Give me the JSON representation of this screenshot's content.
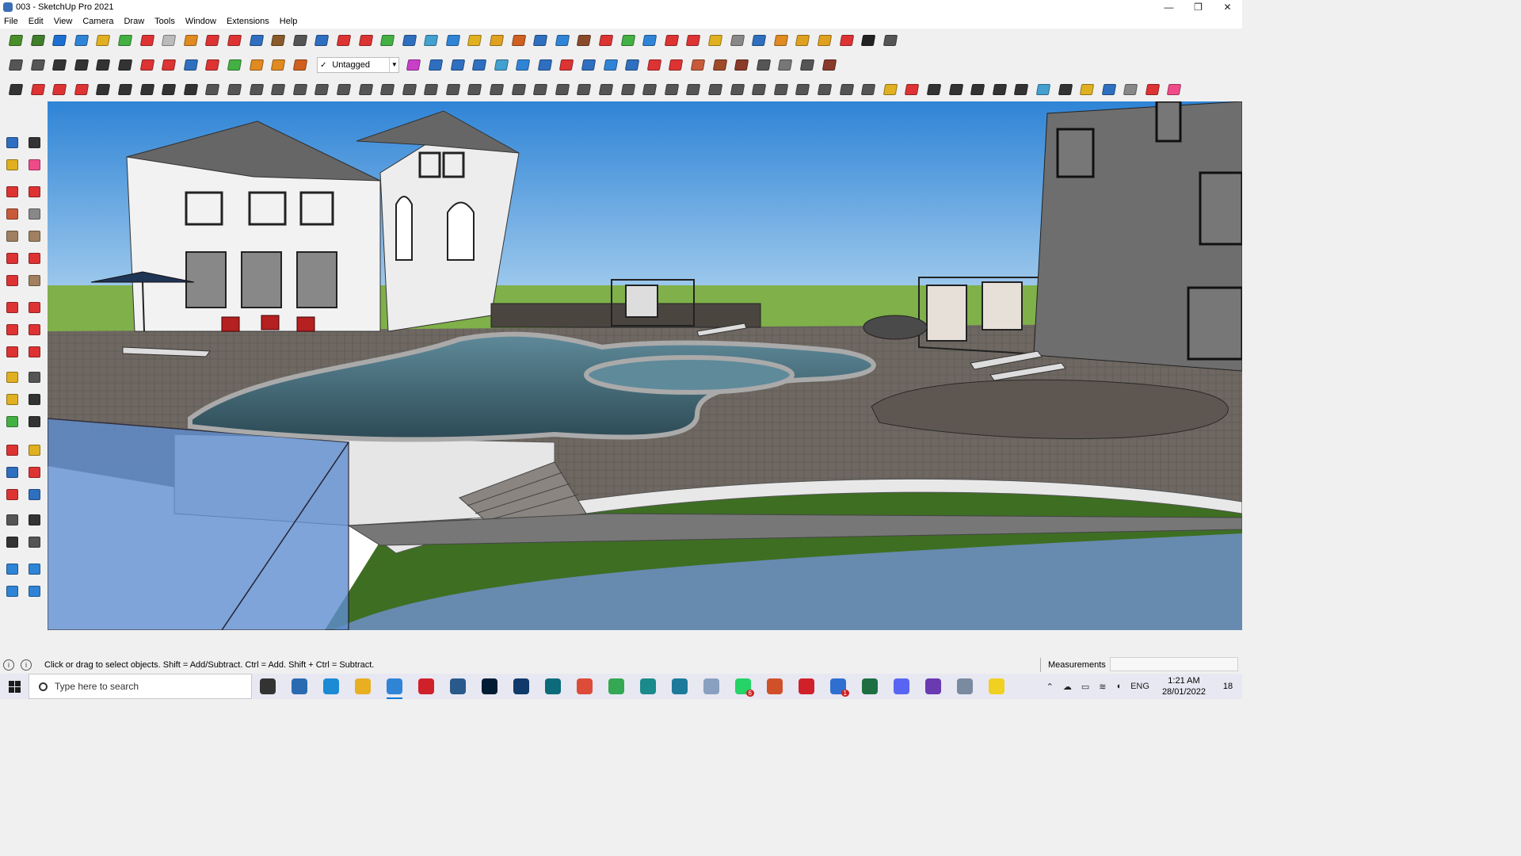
{
  "window": {
    "title": "003 - SketchUp Pro 2021",
    "controls": {
      "minimize": "—",
      "maximize": "❐",
      "close": "✕"
    }
  },
  "menu": [
    "File",
    "Edit",
    "View",
    "Camera",
    "Draw",
    "Tools",
    "Window",
    "Extensions",
    "Help"
  ],
  "tag_selector": {
    "check": "✓",
    "value": "Untagged",
    "arrow": "▼"
  },
  "toolbar_colors": {
    "row1": [
      "#4a8f2a",
      "#3f7f2a",
      "#1e6fd1",
      "#2f84d6",
      "#e0b020",
      "#43b043",
      "#d33",
      "#bbb",
      "#e08a20",
      "#d33",
      "#d33",
      "#2f6fc0",
      "#8a5a2a",
      "#555",
      "#2f6fc0",
      "#d33",
      "#d33",
      "#43b043",
      "#2f6fc0",
      "#43a0d0",
      "#2f84d6",
      "#e0b020",
      "#e0a020",
      "#d06020",
      "#2f6fc0",
      "#2f84d6",
      "#8a4a2a",
      "#d33",
      "#43b043",
      "#2f84d6",
      "#d33",
      "#d33",
      "#e0b020",
      "#888",
      "#2f6fc0",
      "#e08a20",
      "#e0a020",
      "#e0a020",
      "#d33",
      "#222",
      "#555"
    ],
    "row2": [
      "#555",
      "#555",
      "#333",
      "#333",
      "#333",
      "#333",
      "#d33",
      "#d33",
      "#2f6fc0",
      "#d33",
      "#43b043",
      "#e08a20",
      "#e08a20",
      "#d06020",
      "#c83fc8",
      "#2f6fc0",
      "#2f6fc0",
      "#2f6fc0",
      "#43a0d0",
      "#2f84d6",
      "#2f6fc0",
      "#d33",
      "#2f6fc0",
      "#2f84d6",
      "#2f6fc0",
      "#d33",
      "#d33",
      "#c85a3a",
      "#a04a2a",
      "#8a3a2a",
      "#555",
      "#777",
      "#555",
      "#8a3a2a"
    ],
    "row3": [
      "#333",
      "#d33",
      "#d33",
      "#d33",
      "#333",
      "#333",
      "#333",
      "#333",
      "#333",
      "#555",
      "#555",
      "#555",
      "#555",
      "#555",
      "#555",
      "#555",
      "#555",
      "#555",
      "#555",
      "#555",
      "#555",
      "#555",
      "#555",
      "#555",
      "#555",
      "#555",
      "#555",
      "#555",
      "#555",
      "#555",
      "#555",
      "#555",
      "#555",
      "#555",
      "#555",
      "#555",
      "#555",
      "#555",
      "#555",
      "#555",
      "#e0b020",
      "#d33",
      "#333",
      "#333",
      "#333",
      "#333",
      "#333",
      "#43a0d0",
      "#333",
      "#e0b020",
      "#2f6fc0",
      "#888",
      "#d33",
      "#f04a8a"
    ]
  },
  "left_tool_colors": [
    "#2f6fc0",
    "#333",
    "#e0b020",
    "#f04a8a",
    "#d33",
    "#d33",
    "#c85a3a",
    "#888",
    "#a08060",
    "#a08060",
    "#d33",
    "#d33",
    "#d33",
    "#a08060",
    "#d33",
    "#d33",
    "#d33",
    "#d33",
    "#d33",
    "#d33",
    "#e0b020",
    "#555",
    "#e0b020",
    "#333",
    "#43b043",
    "#333",
    "#d33",
    "#e0b020",
    "#2f6fc0",
    "#d33",
    "#d33",
    "#2f6fc0",
    "#555",
    "#333",
    "#333",
    "#555",
    "#2f84d6",
    "#2f84d6",
    "#2f84d6",
    "#2f84d6"
  ],
  "status": {
    "hint": "Click or drag to select objects. Shift = Add/Subtract. Ctrl = Add. Shift + Ctrl = Subtract.",
    "measurements_label": "Measurements",
    "measurements_value": "",
    "icons": [
      "i",
      "i"
    ]
  },
  "taskbar": {
    "search_placeholder": "Type here to search",
    "apps": [
      {
        "name": "task-view",
        "color": "#333"
      },
      {
        "name": "calculator",
        "color": "#2a6ab0"
      },
      {
        "name": "edge",
        "color": "#1c8ad4"
      },
      {
        "name": "file-explorer",
        "color": "#e8b020"
      },
      {
        "name": "sketchup",
        "color": "#2f84d6"
      },
      {
        "name": "acrobat",
        "color": "#d0202a"
      },
      {
        "name": "app-7",
        "color": "#2a5a8a"
      },
      {
        "name": "photoshop",
        "color": "#001d34"
      },
      {
        "name": "photoshop-2",
        "color": "#0f3a6a"
      },
      {
        "name": "app-10",
        "color": "#0b6b7a"
      },
      {
        "name": "chrome",
        "color": "#dd4b39"
      },
      {
        "name": "chrome-2",
        "color": "#34a853"
      },
      {
        "name": "app-13",
        "color": "#1a8a8a"
      },
      {
        "name": "app-14",
        "color": "#1e7a9a"
      },
      {
        "name": "app-15",
        "color": "#8aa0c0"
      },
      {
        "name": "whatsapp",
        "color": "#25d366"
      },
      {
        "name": "grammarly",
        "color": "#d0502a"
      },
      {
        "name": "opera",
        "color": "#d0202a"
      },
      {
        "name": "todo",
        "color": "#2f6fd0"
      },
      {
        "name": "excel",
        "color": "#1d6f42"
      },
      {
        "name": "discord",
        "color": "#5865f2"
      },
      {
        "name": "app-22",
        "color": "#6a3ab0"
      },
      {
        "name": "app-23",
        "color": "#7a8aa0"
      },
      {
        "name": "sticky-notes",
        "color": "#f0d020"
      }
    ],
    "badges": {
      "whatsapp": "6",
      "todo": "1"
    },
    "lang": "ENG",
    "time": "1:21 AM",
    "date": "28/01/2022",
    "notifications": "18"
  }
}
